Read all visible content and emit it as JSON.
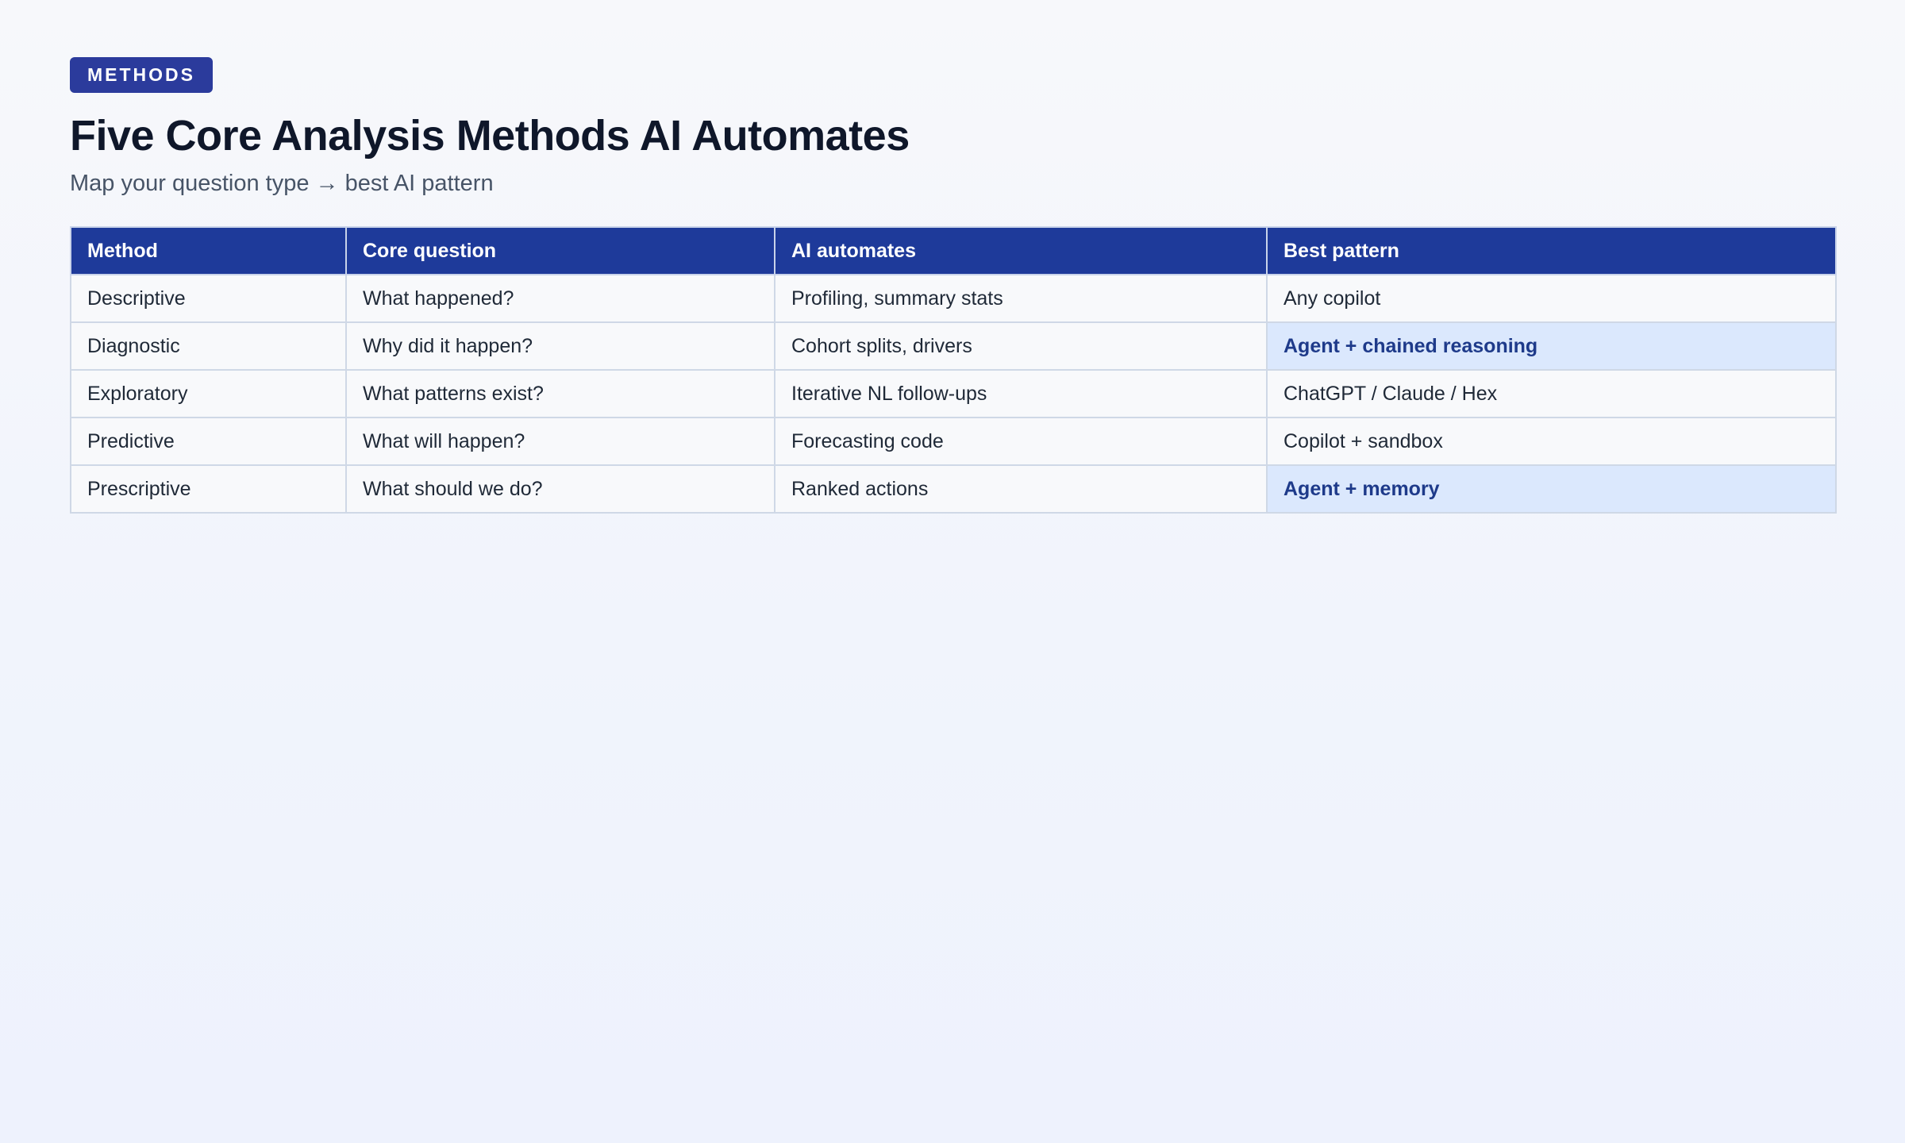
{
  "badge": "METHODS",
  "title": "Five Core Analysis Methods AI Automates",
  "subtitle": "Map your question type → best AI pattern",
  "colors": {
    "badge_bg": "#2b3b9c",
    "header_bg": "#1e3a9a",
    "highlight_bg": "#dbe8fd",
    "highlight_text": "#1e3a8a"
  },
  "table": {
    "headers": [
      "Method",
      "Core question",
      "AI automates",
      "Best pattern"
    ],
    "rows": [
      {
        "method": "Descriptive",
        "question": "What happened?",
        "automates": "Profiling, summary stats",
        "pattern": "Any copilot",
        "highlight": false
      },
      {
        "method": "Diagnostic",
        "question": "Why did it happen?",
        "automates": "Cohort splits, drivers",
        "pattern": "Agent + chained reasoning",
        "highlight": true
      },
      {
        "method": "Exploratory",
        "question": "What patterns exist?",
        "automates": "Iterative NL follow-ups",
        "pattern": "ChatGPT / Claude / Hex",
        "highlight": false
      },
      {
        "method": "Predictive",
        "question": "What will happen?",
        "automates": "Forecasting code",
        "pattern": "Copilot + sandbox",
        "highlight": false
      },
      {
        "method": "Prescriptive",
        "question": "What should we do?",
        "automates": "Ranked actions",
        "pattern": "Agent + memory",
        "highlight": true
      }
    ]
  }
}
